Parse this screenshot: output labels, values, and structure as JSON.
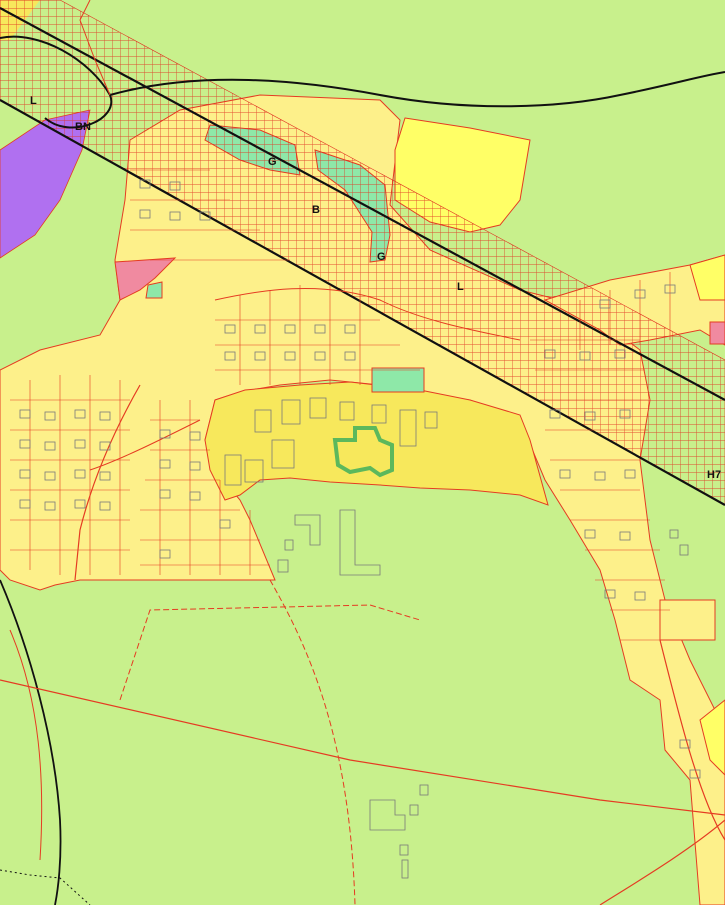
{
  "map": {
    "colors": {
      "background": "#c8f08c",
      "residential": "#fdf08a",
      "residential_dark": "#f7e85c",
      "yellow_strong": "#ffff66",
      "purple": "#b070f0",
      "pink": "#f08aa0",
      "green_park": "#8ee8a8",
      "hatch": "#e03020",
      "boundary": "#e53b22",
      "line_black": "#111111",
      "building": "#7a7a7a"
    },
    "labels": {
      "l_top_left": "L",
      "bn": "BN",
      "g_upper": "G",
      "b": "B",
      "g_lower": "G",
      "l_center": "L",
      "h7": "H7"
    }
  }
}
